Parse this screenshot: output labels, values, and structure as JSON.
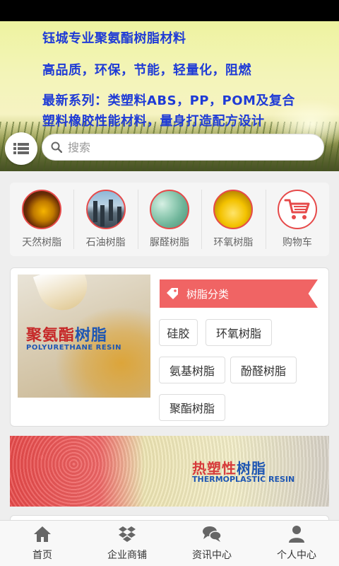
{
  "hero": {
    "line1": "钰城专业聚氨酯树脂材料",
    "line2": "高品质，环保，节能，轻量化，阻燃",
    "line3": "最新系列：类塑料ABS，PP，POM及复合",
    "line4": "塑料橡胶性能材料，量身打造配方设计"
  },
  "search": {
    "placeholder": "搜索"
  },
  "categories": [
    {
      "label": "天然树脂",
      "icon": "natural-resin-image"
    },
    {
      "label": "石油树脂",
      "icon": "petroleum-refinery-image"
    },
    {
      "label": "脲醛树脂",
      "icon": "urea-resin-image"
    },
    {
      "label": "环氧树脂",
      "icon": "epoxy-resin-image"
    },
    {
      "label": "购物车",
      "icon": "shopping-cart-icon"
    }
  ],
  "feature": {
    "image_title_red": "聚氨酯",
    "image_title_blue": "树脂",
    "image_subtitle": "POLYURETHANE RESIN",
    "section_title": "树脂分类",
    "tags": [
      "硅胶",
      "环氧树脂",
      "氨基树脂",
      "酚醛树脂",
      "聚酯树脂"
    ]
  },
  "banner": {
    "title_red": "热塑性",
    "title_blue": "树脂",
    "subtitle": "THERMOPLASTIC RESIN"
  },
  "tabs": [
    {
      "label": "首页",
      "icon": "home-icon"
    },
    {
      "label": "企业商铺",
      "icon": "dropbox-icon"
    },
    {
      "label": "资讯中心",
      "icon": "chat-bubbles-icon"
    },
    {
      "label": "个人中心",
      "icon": "user-icon"
    }
  ],
  "colors": {
    "accent_red": "#f06464",
    "hero_text": "#1f3bd6"
  }
}
